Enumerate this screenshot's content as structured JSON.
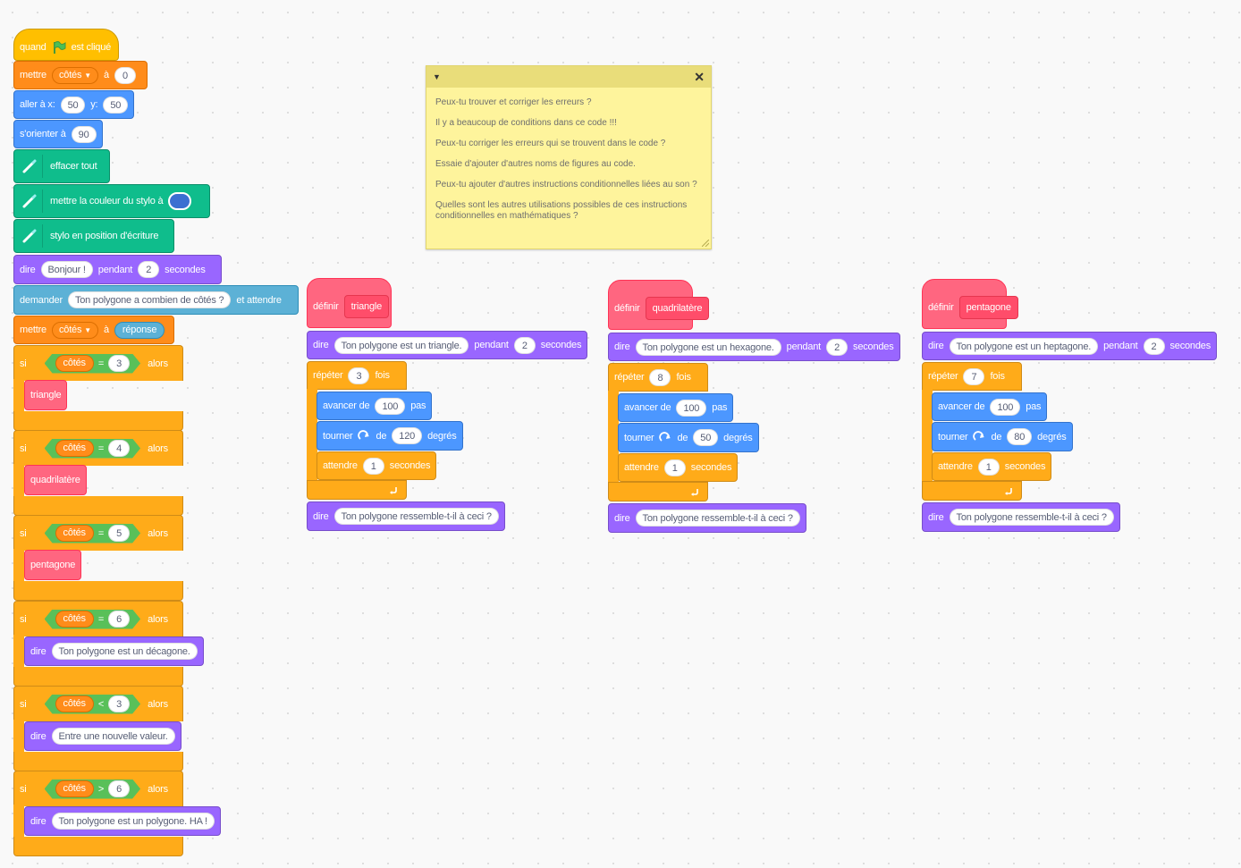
{
  "events": {
    "when": "quand",
    "flag_clicked": "est cliqué"
  },
  "main_script": {
    "set1": {
      "label": "mettre",
      "var": "côtés",
      "to": "à",
      "value": "0"
    },
    "goto": {
      "label": "aller à x:",
      "x": "50",
      "y_label": "y:",
      "y": "50"
    },
    "point": {
      "label": "s'orienter à",
      "value": "90"
    },
    "clear": {
      "label": "effacer tout"
    },
    "pencolor": {
      "label": "mettre la couleur du stylo à",
      "color": "#3b6fd1"
    },
    "pendown": {
      "label": "stylo en position d'écriture"
    },
    "say": {
      "label": "dire",
      "text": "Bonjour !",
      "for": "pendant",
      "secs": "2",
      "unit": "secondes"
    },
    "ask": {
      "label": "demander",
      "text": "Ton polygone a combien de côtés ?",
      "wait": "et attendre"
    },
    "set2": {
      "label": "mettre",
      "var": "côtés",
      "to": "à",
      "value": "réponse"
    },
    "ifs": [
      {
        "kw": "si",
        "var": "côtés",
        "op": "=",
        "num": "3",
        "then": "alors",
        "body_type": "call",
        "body": "triangle"
      },
      {
        "kw": "si",
        "var": "côtés",
        "op": "=",
        "num": "4",
        "then": "alors",
        "body_type": "call",
        "body": "quadrilatère"
      },
      {
        "kw": "si",
        "var": "côtés",
        "op": "=",
        "num": "5",
        "then": "alors",
        "body_type": "call",
        "body": "pentagone"
      },
      {
        "kw": "si",
        "var": "côtés",
        "op": "=",
        "num": "6",
        "then": "alors",
        "body_type": "say",
        "say": "dire",
        "body": "Ton polygone est un décagone."
      },
      {
        "kw": "si",
        "var": "côtés",
        "op": "<",
        "num": "3",
        "then": "alors",
        "body_type": "say",
        "say": "dire",
        "body": "Entre une nouvelle valeur."
      },
      {
        "kw": "si",
        "var": "côtés",
        "op": ">",
        "num": "6",
        "then": "alors",
        "body_type": "say",
        "say": "dire",
        "body": "Ton polygone est un polygone. HA !"
      }
    ]
  },
  "defs": [
    {
      "define": "définir",
      "name": "triangle",
      "say": "dire",
      "say_text": "Ton polygone est un triangle.",
      "for": "pendant",
      "secs": "2",
      "unit": "secondes",
      "repeat": "répéter",
      "times": "3",
      "fois": "fois",
      "move": "avancer de",
      "steps": "100",
      "pas": "pas",
      "turn": "tourner",
      "de": "de",
      "deg": "120",
      "degres": "degrés",
      "wait": "attendre",
      "wait_secs": "1",
      "wait_unit": "secondes",
      "say2_text": "Ton polygone ressemble-t-il à ceci ?"
    },
    {
      "define": "définir",
      "name": "quadrilatère",
      "say": "dire",
      "say_text": "Ton polygone est un hexagone.",
      "for": "pendant",
      "secs": "2",
      "unit": "secondes",
      "repeat": "répéter",
      "times": "8",
      "fois": "fois",
      "move": "avancer de",
      "steps": "100",
      "pas": "pas",
      "turn": "tourner",
      "de": "de",
      "deg": "50",
      "degres": "degrés",
      "wait": "attendre",
      "wait_secs": "1",
      "wait_unit": "secondes",
      "say2_text": "Ton polygone ressemble-t-il à ceci ?"
    },
    {
      "define": "définir",
      "name": "pentagone",
      "say": "dire",
      "say_text": "Ton polygone est un heptagone.",
      "for": "pendant",
      "secs": "2",
      "unit": "secondes",
      "repeat": "répéter",
      "times": "7",
      "fois": "fois",
      "move": "avancer de",
      "steps": "100",
      "pas": "pas",
      "turn": "tourner",
      "de": "de",
      "deg": "80",
      "degres": "degrés",
      "wait": "attendre",
      "wait_secs": "1",
      "wait_unit": "secondes",
      "say2_text": "Ton polygone ressemble-t-il à ceci ?"
    }
  ],
  "comment": {
    "lines": [
      "Peux-tu trouver et corriger les erreurs ?",
      "Il y a beaucoup de conditions dans ce code !!!",
      "Peux-tu corriger les erreurs qui se trouvent dans le code ?",
      "Essaie d'ajouter d'autres noms de figures au code.",
      "Peux-tu ajouter d'autres instructions conditionnelles liées au son ?",
      "Quelles sont les autres utilisations possibles de ces instructions conditionnelles en mathématiques ?"
    ]
  },
  "icons": {
    "flag": "green-flag-icon",
    "pen": "pen-extension-icon",
    "turn": "turn-right-icon",
    "loop": "loop-arrow-icon",
    "collapse": "triangle-down-icon",
    "close": "close-icon"
  }
}
